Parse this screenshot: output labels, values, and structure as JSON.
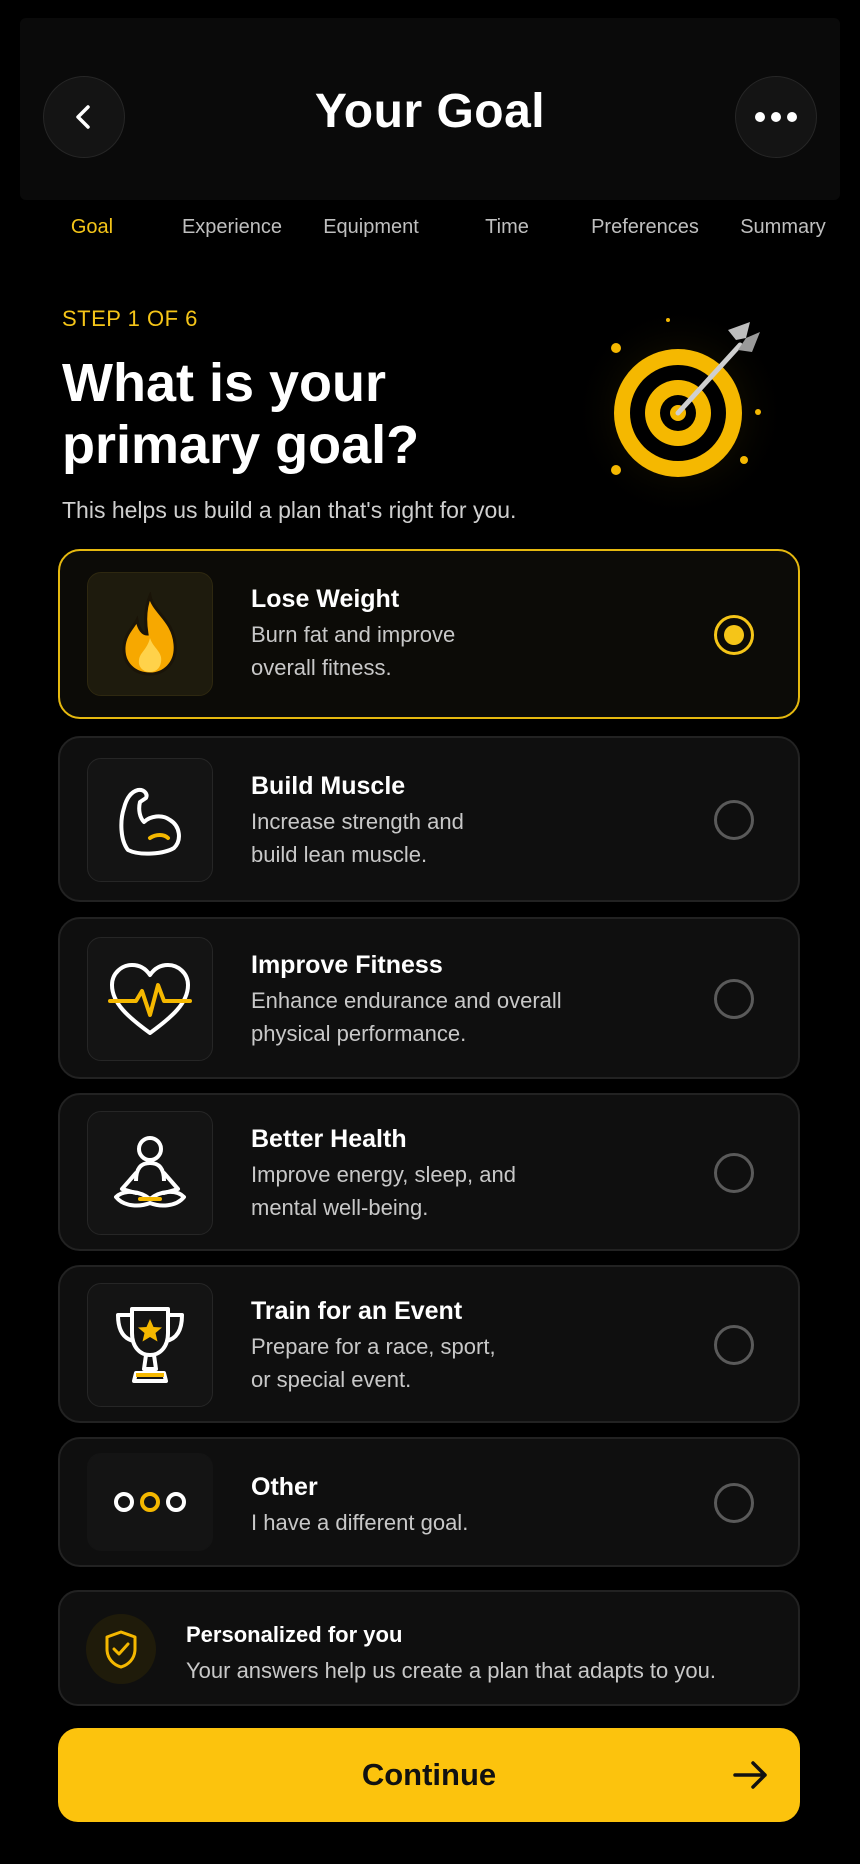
{
  "header": {
    "title": "Your Goal",
    "back_icon": "chevron-left-icon",
    "more_icon": "more-horizontal-icon"
  },
  "tabs": [
    {
      "label": "Goal",
      "active": true
    },
    {
      "label": "Experience",
      "active": false
    },
    {
      "label": "Equipment",
      "active": false
    },
    {
      "label": "Time",
      "active": false
    },
    {
      "label": "Preferences",
      "active": false
    },
    {
      "label": "Summary",
      "active": false
    }
  ],
  "intro": {
    "step": "STEP 1 OF 6",
    "question": "What is your primary goal?",
    "subtitle": "This helps us build a plan that's right for you."
  },
  "options": [
    {
      "title": "Lose Weight",
      "desc_line1": "Burn fat and improve",
      "desc_line2": "overall fitness.",
      "icon": "flame-icon",
      "selected": true
    },
    {
      "title": "Build Muscle",
      "desc_line1": "Increase strength and",
      "desc_line2": "build lean muscle.",
      "icon": "flexed-bicep-icon",
      "selected": false
    },
    {
      "title": "Improve Fitness",
      "desc_line1": "Enhance endurance and overall",
      "desc_line2": "physical performance.",
      "icon": "heart-pulse-icon",
      "selected": false
    },
    {
      "title": "Better Health",
      "desc_line1": "Improve energy, sleep, and",
      "desc_line2": "mental well-being.",
      "icon": "meditation-icon",
      "selected": false
    },
    {
      "title": "Train for an Event",
      "desc_line1": "Prepare for a race, sport,",
      "desc_line2": "or special event.",
      "icon": "trophy-icon",
      "selected": false
    },
    {
      "title": "Other",
      "desc_line1": "I have a different goal.",
      "desc_line2": "",
      "icon": "three-dots-icon",
      "selected": false
    }
  ],
  "info": {
    "title": "Personalized for you",
    "desc": "Your answers help us create a plan that adapts to you.",
    "icon": "shield-check-icon"
  },
  "cta": {
    "label": "Continue",
    "icon": "arrow-right-icon"
  },
  "colors": {
    "accent": "#f5c518",
    "button": "#fcc30d",
    "background": "#000000"
  }
}
